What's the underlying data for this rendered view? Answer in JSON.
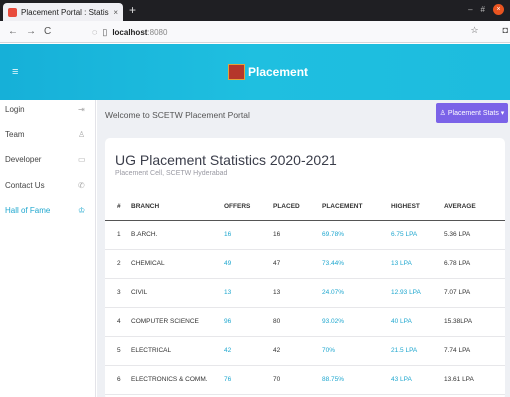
{
  "browser": {
    "tab_label": "Placement Portal : Statis",
    "tab_close": "×",
    "new_tab": "+",
    "back": "←",
    "forward": "→",
    "reload": "C",
    "url_host": "localhost",
    "url_port": ":8080",
    "win_minimize": "–",
    "win_maximize": "#",
    "win_close": "×"
  },
  "header": {
    "menu_icon": "≡",
    "brand": "Placement"
  },
  "sidebar": {
    "items": [
      {
        "label": "Login",
        "icon": "⇥"
      },
      {
        "label": "Team",
        "icon": "♙"
      },
      {
        "label": "Developer",
        "icon": "▭"
      },
      {
        "label": "Contact Us",
        "icon": "✆"
      },
      {
        "label": "Hall of Fame",
        "icon": "♔"
      }
    ]
  },
  "main": {
    "welcome": "Welcome to SCETW Placement Portal",
    "stats_button": "♙ Placement Stats ▾"
  },
  "card": {
    "title": "UG Placement Statistics 2020-2021",
    "subtitle": "Placement Cell, SCETW Hyderabad",
    "columns": [
      "#",
      "BRANCH",
      "OFFERS",
      "PLACED",
      "PLACEMENT",
      "HIGHEST",
      "AVERAGE"
    ],
    "rows": [
      {
        "num": "1",
        "branch": "B.ARCH.",
        "offers": "16",
        "placed": "16",
        "placement": "69.78%",
        "highest": "6.75 LPA",
        "average": "5.36 LPA"
      },
      {
        "num": "2",
        "branch": "CHEMICAL",
        "offers": "49",
        "placed": "47",
        "placement": "73.44%",
        "highest": "13 LPA",
        "average": "6.78 LPA"
      },
      {
        "num": "3",
        "branch": "CIVIL",
        "offers": "13",
        "placed": "13",
        "placement": "24.07%",
        "highest": "12.93 LPA",
        "average": "7.07 LPA"
      },
      {
        "num": "4",
        "branch": "COMPUTER SCIENCE",
        "offers": "96",
        "placed": "80",
        "placement": "93.02%",
        "highest": "40 LPA",
        "average": "15.38LPA"
      },
      {
        "num": "5",
        "branch": "ELECTRICAL",
        "offers": "42",
        "placed": "42",
        "placement": "70%",
        "highest": "21.5 LPA",
        "average": "7.74 LPA"
      },
      {
        "num": "6",
        "branch": "ELECTRONICS & COMM.",
        "offers": "76",
        "placed": "70",
        "placement": "88.75%",
        "highest": "43 LPA",
        "average": "13.61 LPA"
      }
    ]
  },
  "colors": {
    "header": "#1fbfe0",
    "accent": "#1fa7cf",
    "stats_button": "#7b63e8"
  }
}
